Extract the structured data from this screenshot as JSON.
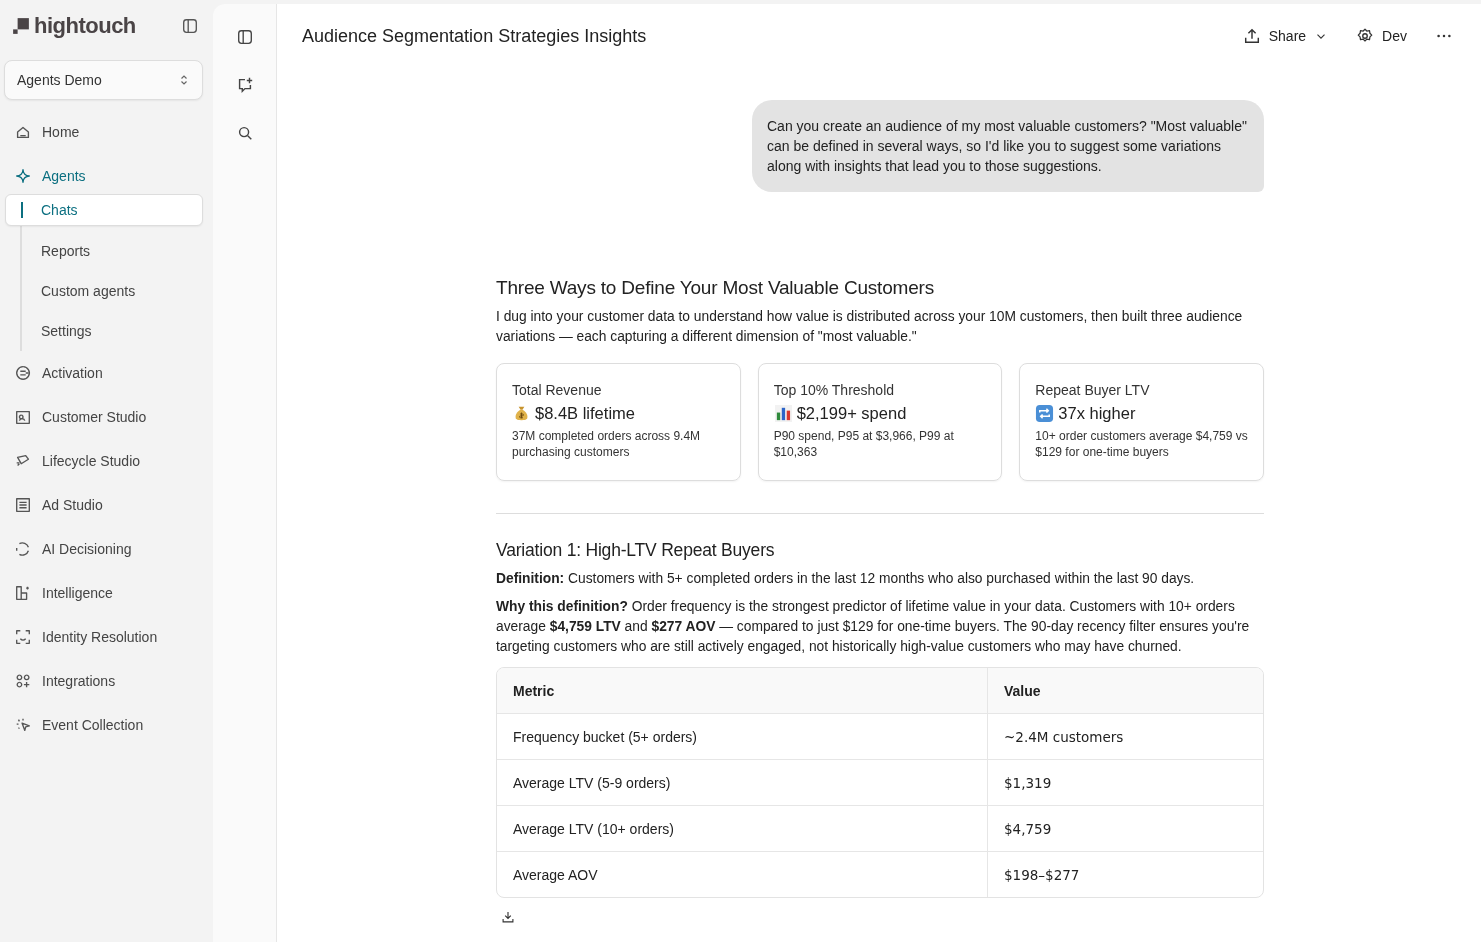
{
  "sidebar": {
    "logo": "hightouch",
    "workspace": "Agents Demo",
    "items": [
      {
        "label": "Home",
        "selected": false
      },
      {
        "label": "Agents",
        "selected": true,
        "children": [
          {
            "label": "Chats",
            "selected": true
          },
          {
            "label": "Reports",
            "selected": false
          },
          {
            "label": "Custom agents",
            "selected": false
          },
          {
            "label": "Settings",
            "selected": false
          }
        ]
      },
      {
        "label": "Activation",
        "selected": false
      },
      {
        "label": "Customer Studio",
        "selected": false
      },
      {
        "label": "Lifecycle Studio",
        "selected": false
      },
      {
        "label": "Ad Studio",
        "selected": false
      },
      {
        "label": "AI Decisioning",
        "selected": false
      },
      {
        "label": "Intelligence",
        "selected": false
      },
      {
        "label": "Identity Resolution",
        "selected": false
      },
      {
        "label": "Integrations",
        "selected": false
      },
      {
        "label": "Event Collection",
        "selected": false
      }
    ]
  },
  "header": {
    "title": "Audience Segmentation Strategies Insights",
    "share": "Share",
    "dev": "Dev"
  },
  "user_message": "Can you create an audience of my most valuable customers?  \"Most valuable\" can be defined in several ways, so I'd like you to suggest some variations along with insights that lead you to those suggestions.",
  "response": {
    "heading": "Three Ways to Define Your Most Valuable Customers",
    "intro": "I dug into your customer data to understand how value is distributed across your 10M customers, then built three audience variations — each capturing a different dimension of \"most valuable.\"",
    "cards": [
      {
        "title": "Total Revenue",
        "value": "$8.4B lifetime",
        "description": "37M completed orders across 9.4M purchasing customers"
      },
      {
        "title": "Top 10% Threshold",
        "value": "$2,199+ spend",
        "description": "P90 spend, P95 at $3,966, P99 at $10,363"
      },
      {
        "title": "Repeat Buyer LTV",
        "value": "37x higher",
        "description": "10+ order customers average $4,759 vs $129 for one-time buyers"
      }
    ],
    "section_heading": "Variation 1: High-LTV Repeat Buyers",
    "paragraphs": [
      "**Definition:** Customers with 5+ completed orders in the last 12 months who also purchased within the last 90 days.",
      "**Why this definition?** Order frequency is the strongest predictor of lifetime value in your data. Customers with 10+ orders average **$4,759 LTV** and **$277 AOV** — compared to just $129 for one-time buyers. The 90-day recency filter ensures you're targeting customers who are still actively engaged, not historically high-value customers who may have churned."
    ],
    "table": {
      "columns": [
        "Metric",
        "Value"
      ],
      "rows": [
        [
          "Frequency bucket (5+ orders)",
          "~2.4M customers"
        ],
        [
          "Average LTV (5-9 orders)",
          "$1,319"
        ],
        [
          "Average LTV (10+ orders)",
          "$4,759"
        ],
        [
          "Average AOV",
          "$198–$277"
        ]
      ]
    }
  }
}
